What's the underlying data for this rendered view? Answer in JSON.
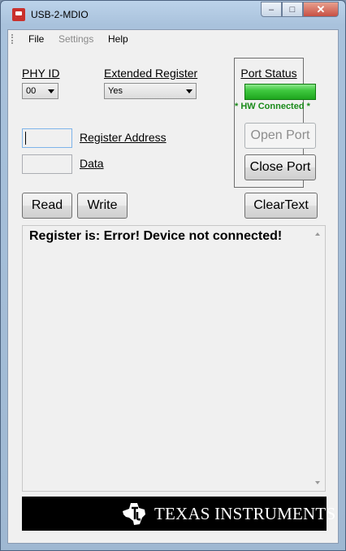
{
  "window": {
    "title": "USB-2-MDIO"
  },
  "caption_buttons": {
    "minimize": "–",
    "maximize": "□",
    "close": "✕"
  },
  "menu": {
    "file": "File",
    "settings": "Settings",
    "help": "Help"
  },
  "phy": {
    "label": "PHY ID",
    "value": "00"
  },
  "extended": {
    "label": "Extended Register",
    "value": "Yes"
  },
  "register": {
    "label": "Register Address",
    "value": ""
  },
  "data_field": {
    "label": "Data",
    "value": ""
  },
  "port": {
    "title": "Port Status",
    "indicator_color": "#2fbf2f",
    "status_text": "*  HW Connected  *",
    "open_label": "Open Port",
    "close_label": "Close Port"
  },
  "actions": {
    "read": "Read",
    "write": "Write",
    "clear": "ClearText"
  },
  "output": {
    "text": "Register  is: Error! Device not connected!"
  },
  "logo": {
    "text": "TEXAS INSTRUMENTS"
  }
}
